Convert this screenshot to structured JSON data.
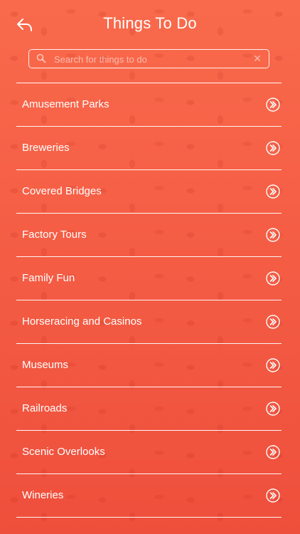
{
  "header": {
    "title": "Things To Do",
    "back_icon": "back-arrow-icon"
  },
  "search": {
    "placeholder": "Search for things to do",
    "value": "",
    "clear_symbol": "✕"
  },
  "list": {
    "items": [
      {
        "label": "Amusement Parks"
      },
      {
        "label": "Breweries"
      },
      {
        "label": "Covered Bridges"
      },
      {
        "label": "Factory Tours"
      },
      {
        "label": "Family Fun"
      },
      {
        "label": "Horseracing and Casinos"
      },
      {
        "label": "Museums"
      },
      {
        "label": "Railroads"
      },
      {
        "label": "Scenic Overlooks"
      },
      {
        "label": "Wineries"
      }
    ]
  },
  "colors": {
    "background": "#f45c44",
    "text": "#ffffff"
  }
}
